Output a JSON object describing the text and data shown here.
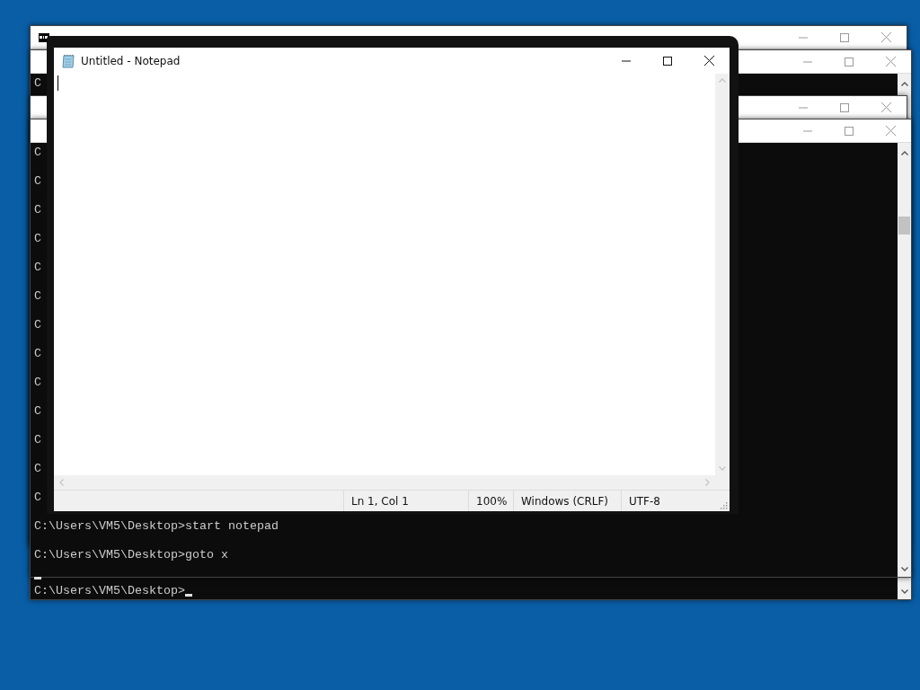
{
  "consoles": [
    {
      "kind": "console"
    },
    {
      "kind": "console",
      "lines": [
        "C"
      ],
      "prompt": "C:\\Users\\VM5\\Desktop>",
      "cursor": true
    },
    {
      "kind": "console"
    },
    {
      "kind": "console",
      "lines": [
        "C",
        "C",
        "C",
        "C",
        "C",
        "C",
        "C",
        "C",
        "C",
        "C",
        "C",
        "C",
        "C",
        "C:\\Users\\VM5\\Desktop>start notepad",
        "C:\\Users\\VM5\\Desktop>goto x"
      ],
      "cursor": true
    }
  ],
  "notepad": {
    "title": "Untitled - Notepad",
    "status": [
      "Ln 1, Col 1",
      "100%",
      "Windows (CRLF)",
      "UTF-8"
    ]
  }
}
